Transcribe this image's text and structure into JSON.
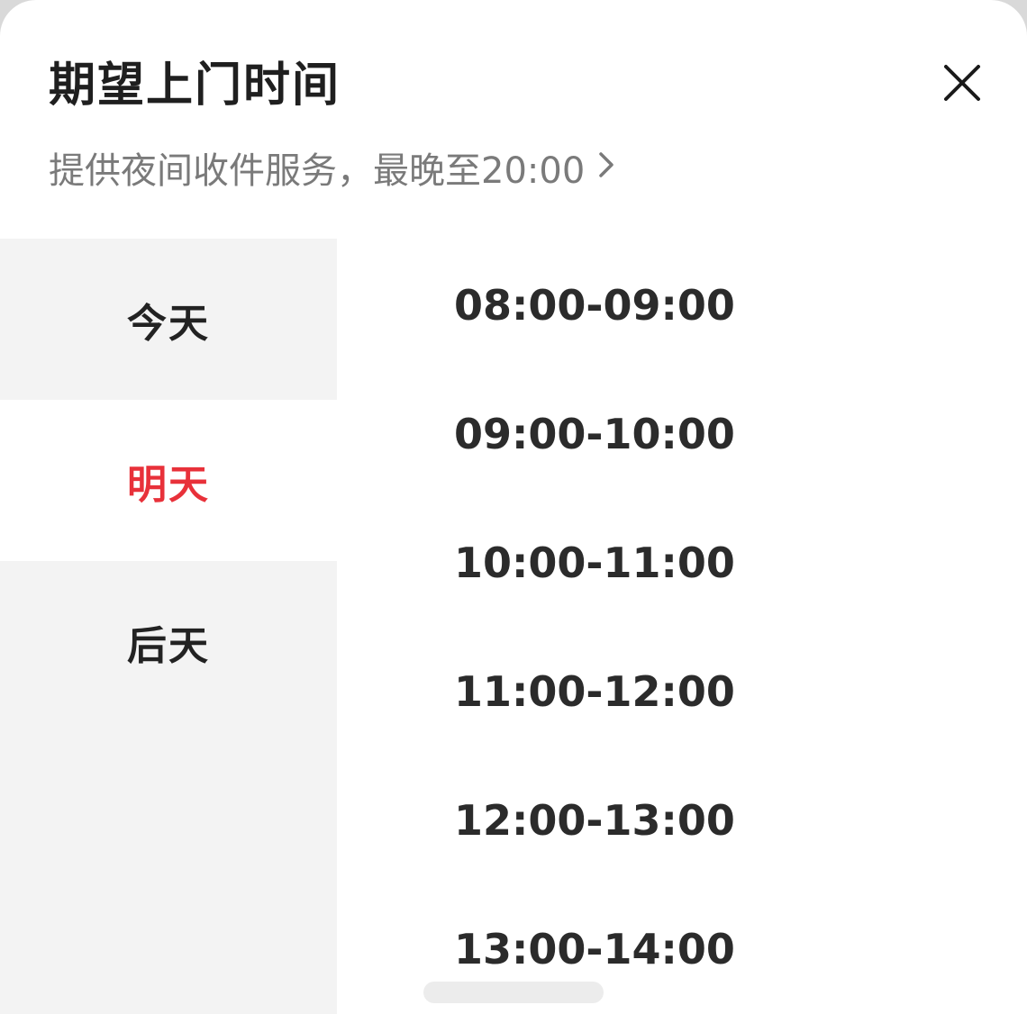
{
  "header": {
    "title": "期望上门时间",
    "subtitle": "提供夜间收件服务，最晚至20:00",
    "close_icon": "close-icon",
    "chevron_icon": "chevron-right-icon"
  },
  "days": [
    {
      "label": "今天",
      "selected": false
    },
    {
      "label": "明天",
      "selected": true
    },
    {
      "label": "后天",
      "selected": false
    }
  ],
  "time_slots": [
    "08:00-09:00",
    "09:00-10:00",
    "10:00-11:00",
    "11:00-12:00",
    "12:00-13:00",
    "13:00-14:00"
  ],
  "colors": {
    "accent": "#e8313a",
    "sidebar_bg": "#f3f3f3",
    "text_primary": "#1f1f1f",
    "text_secondary": "#7a7a7a"
  }
}
